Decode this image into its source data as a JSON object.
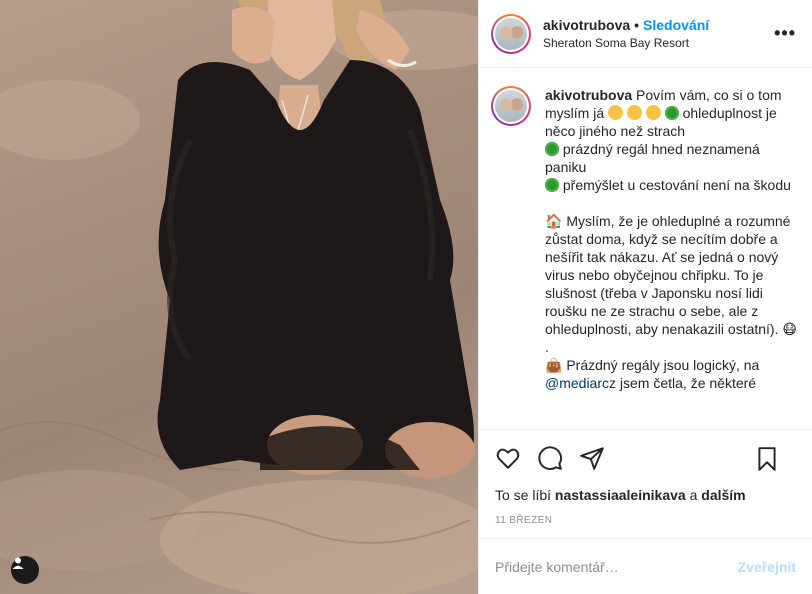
{
  "post": {
    "username": "akivotrubova",
    "separator": "•",
    "follow_label": "Sledování",
    "location": "Sheraton Soma Bay Resort",
    "more_label": "•••"
  },
  "caption": {
    "username": "akivotrubova",
    "l1a": "Povím vám, co si o tom myslím já",
    "l2": "ohleduplnost je něco jiného než strach",
    "l3": "prázdný regál hned neznamená paniku",
    "l4": "přemýšlet u cestování není na škodu",
    "p2": "Myslím, že je ohleduplné a rozumné zůstat doma, když se necítím dobře a nešířit tak nákazu. Ať se jedná o nový virus nebo obyčejnou chřipku. To je slušnost (třeba v Japonsku nosí lidi roušku ne ze strachu o sebe, ale z ohleduplnosti, aby nenakazili ostatní).",
    "dot": ".",
    "p3a": "Prázdný regály jsou logický, na",
    "mention": "@mediarcz",
    "p3b": "jsem četla, že některé",
    "house_emoji": "🏠",
    "bag_emoji": "👜",
    "mask_emoji": "😷"
  },
  "likes": {
    "prefix": "To se líbí",
    "user": "nastassiaaleinikava",
    "and": "a",
    "others": "dalším"
  },
  "date": "11 BŘEZEN",
  "comment": {
    "placeholder": "Přidejte komentář…",
    "post_label": "Zveřejnit"
  }
}
